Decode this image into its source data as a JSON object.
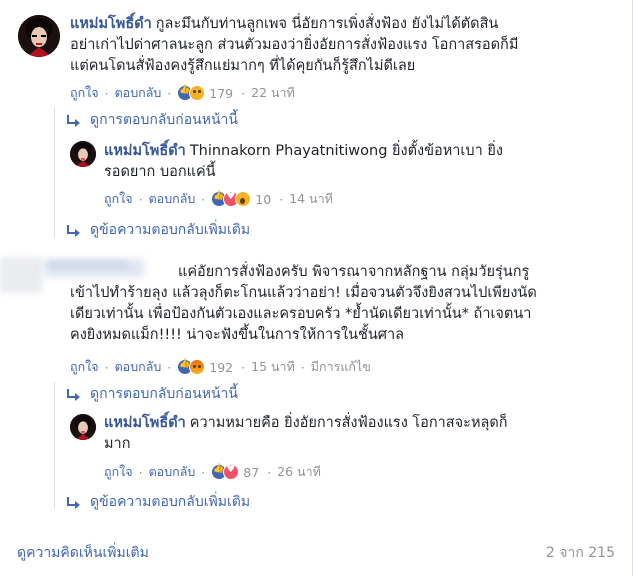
{
  "comments": [
    {
      "author": "แหม่มโพธิ์ดำ",
      "lines": [
        "กูละมึนกับท่านลูกเพจ นี่อัยการเพิ่งสั่งฟ้อง ยังไม่ได้ตัดสิน",
        "อย่าเก่าไปด่าศาลนะลูก ส่วนตัวมองว่ายิ่งอัยการสั่งฟ้องแรง โอกาสรอดก็มี",
        "แต่คนโดนสั่ฟ้องคงรู้สึกแย่มากๆ ที่ได้คุยกันก็รู้สึกไม่ดีเลย"
      ],
      "like_label": "ถูกใจ",
      "reply_label": "ตอบกลับ",
      "reactions": [
        "like",
        "sad"
      ],
      "reaction_count": "179",
      "time": "22 นาที"
    },
    {
      "author": "แหม่มโพธิ์ดำ",
      "mention": "Thinnakorn Phayatnitiwong",
      "lines": [
        "ยิ่งตั้งข้อหาเบา ยิ่ง",
        "รอดยาก บอกแค่นี้"
      ],
      "like_label": "ถูกใจ",
      "reply_label": "ตอบกลับ",
      "reactions": [
        "like",
        "love",
        "wow"
      ],
      "reaction_count": "10",
      "time": "14 นาที"
    },
    {
      "lines": [
        "แค่อัยการสั่งฟ้องครับ พิจารณาจากหลักฐาน กลุ่มวัยรุ่นกรู",
        "เข้าไปทำร้ายลุง แล้วลุงก็ตะโกนแล้วว่าอย่า! เมื่อจวนตัวจึงยิงสวนไปเพียงนัด",
        "เดียวเท่านั้น เพื่อป้องกันตัวเองและครอบครัว *ย้ำนัดเดียวเท่านั้น* ถ้าเจตนา",
        "คงยิงหมดแม็ก!!!! น่าจะฟังขึ้นในการให้การในชั้นศาล"
      ],
      "like_label": "ถูกใจ",
      "reply_label": "ตอบกลับ",
      "reactions": [
        "like",
        "angry"
      ],
      "reaction_count": "192",
      "time": "15 นาที",
      "edited": "มีการแก้ไข"
    },
    {
      "author": "แหม่มโพธิ์ดำ",
      "lines": [
        "ความหมายคือ ยิ่งอัยการสั่งฟ้องแรง โอกาสจะหลุดก็",
        "มาก"
      ],
      "like_label": "ถูกใจ",
      "reply_label": "ตอบกลับ",
      "reactions": [
        "like",
        "love"
      ],
      "reaction_count": "87",
      "time": "26 นาที"
    }
  ],
  "links": {
    "previous_replies": "ดูการตอบกลับก่อนหน้านี้",
    "more_replies": "ดูข้อความตอบกลับเพิ่มเติม"
  },
  "footer": {
    "more_comments": "ดูความคิดเห็นเพิ่มเติม",
    "pagination": "2 จาก 215"
  },
  "colors": {
    "link": "#4267b2",
    "name": "#365899",
    "meta": "#90949c",
    "like": "#4267b2",
    "love": "#f25268",
    "emoji": "#f7b125"
  },
  "icons": [
    "reply-arrow-icon",
    "like-reaction-icon",
    "love-reaction-icon",
    "sad-reaction-icon",
    "wow-reaction-icon",
    "angry-reaction-icon"
  ]
}
